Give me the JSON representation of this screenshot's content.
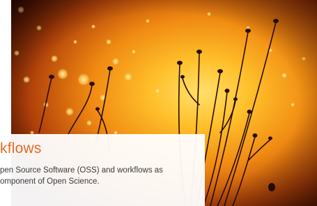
{
  "hero": {
    "image_alt_icon": "dandelion-silhouette-image",
    "colors": {
      "glow_center": "#ffd24a",
      "mid": "#f08a12",
      "edge": "#3a0a02",
      "plant": "#2a0c06"
    }
  },
  "caption": {
    "title": "kflows",
    "body_line_1": "pen Source Software (OSS) and workflows as",
    "body_line_2": "omponent of Open Science.",
    "title_color": "#e56b1f"
  }
}
